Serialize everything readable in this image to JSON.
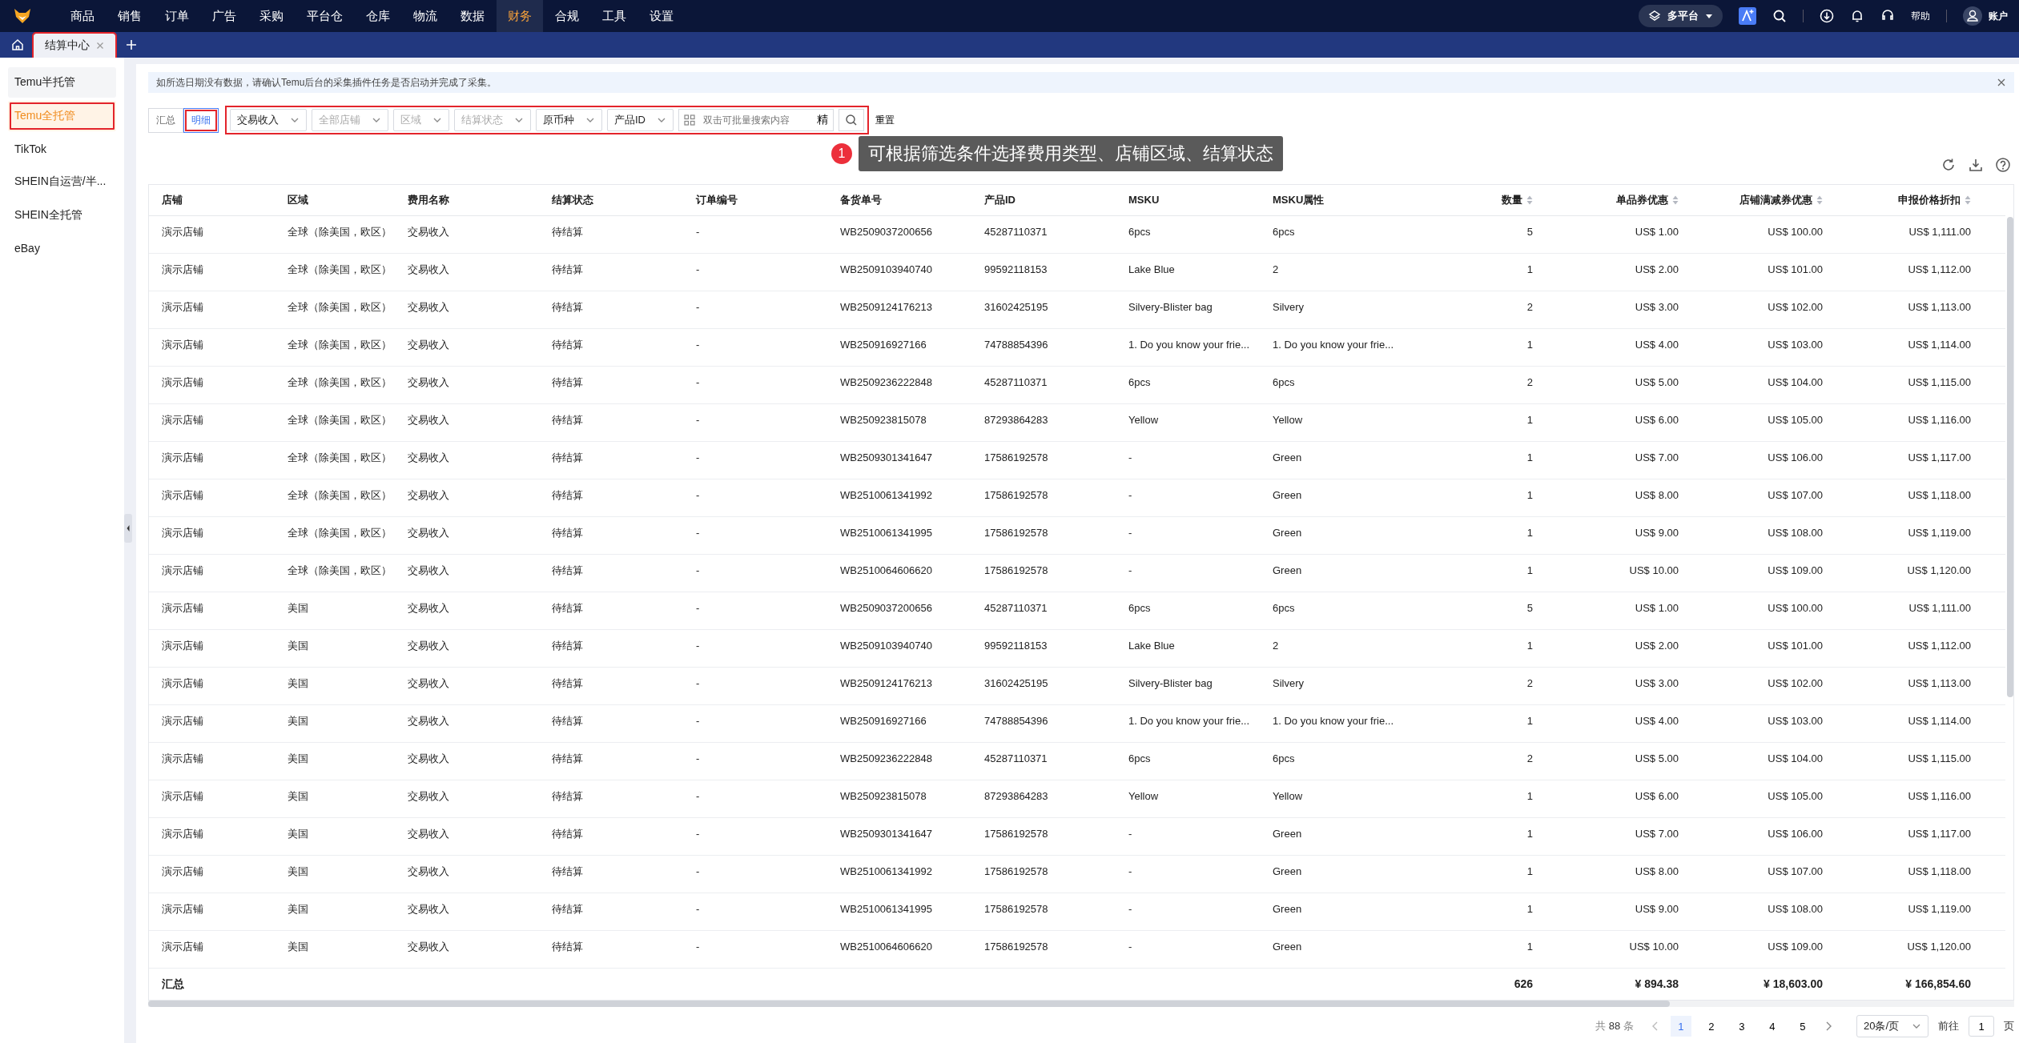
{
  "nav": {
    "menu": [
      {
        "label": "商品",
        "selected": false
      },
      {
        "label": "销售",
        "selected": false
      },
      {
        "label": "订单",
        "selected": false
      },
      {
        "label": "广告",
        "selected": false
      },
      {
        "label": "采购",
        "selected": false
      },
      {
        "label": "平台仓",
        "selected": false
      },
      {
        "label": "仓库",
        "selected": false
      },
      {
        "label": "物流",
        "selected": false
      },
      {
        "label": "数据",
        "selected": false
      },
      {
        "label": "财务",
        "selected": true
      },
      {
        "label": "合规",
        "selected": false
      },
      {
        "label": "工具",
        "selected": false
      },
      {
        "label": "设置",
        "selected": false
      }
    ],
    "platform": "多平台",
    "help": "帮助",
    "account": "账户"
  },
  "tabs": [
    {
      "label": "结算中心",
      "selected": true,
      "highlighted": true
    }
  ],
  "sidebar": {
    "items": [
      {
        "label": "Temu半托管",
        "selected": false,
        "highlighted": false
      },
      {
        "label": "Temu全托管",
        "selected": true,
        "highlighted": true
      },
      {
        "label": "TikTok",
        "selected": false,
        "highlighted": false
      },
      {
        "label": "SHEIN自运营/半...",
        "selected": false,
        "highlighted": false
      },
      {
        "label": "SHEIN全托管",
        "selected": false,
        "highlighted": false
      },
      {
        "label": "eBay",
        "selected": false,
        "highlighted": false
      }
    ]
  },
  "notice": "如所选日期没有数据，请确认Temu后台的采集插件任务是否启动并完成了采集。",
  "view_toggle": [
    {
      "label": "汇总",
      "selected": false,
      "highlighted": false
    },
    {
      "label": "明细",
      "selected": true,
      "highlighted": true
    }
  ],
  "filters": {
    "highlighted": true,
    "items": [
      {
        "kind": "value",
        "text": "交易收入"
      },
      {
        "kind": "placeholder",
        "text": "全部店铺"
      },
      {
        "kind": "placeholder",
        "text": "区域"
      },
      {
        "kind": "placeholder",
        "text": "结算状态"
      },
      {
        "kind": "value",
        "text": "原币种"
      },
      {
        "kind": "value",
        "text": "产品ID"
      }
    ],
    "search": {
      "placeholder": "双击可批量搜索内容",
      "exact": "精"
    },
    "reset": "重置"
  },
  "callout": {
    "number": "1",
    "text": "可根据筛选条件选择费用类型、店铺区域、结算状态"
  },
  "table": {
    "columns": [
      {
        "label": "店铺",
        "kind": "text",
        "sortable": false
      },
      {
        "label": "区域",
        "kind": "text",
        "sortable": false
      },
      {
        "label": "费用名称",
        "kind": "text",
        "sortable": false
      },
      {
        "label": "结算状态",
        "kind": "text",
        "sortable": false
      },
      {
        "label": "订单编号",
        "kind": "text",
        "sortable": false
      },
      {
        "label": "备货单号",
        "kind": "text",
        "sortable": false
      },
      {
        "label": "产品ID",
        "kind": "text",
        "sortable": false
      },
      {
        "label": "MSKU",
        "kind": "text",
        "sortable": false
      },
      {
        "label": "MSKU属性",
        "kind": "text",
        "sortable": false
      },
      {
        "label": "数量",
        "kind": "number",
        "sortable": true
      },
      {
        "label": "单品券优惠",
        "kind": "number",
        "sortable": true
      },
      {
        "label": "店铺满减券优惠",
        "kind": "number",
        "sortable": true
      },
      {
        "label": "申报价格折扣",
        "kind": "number",
        "sortable": true
      }
    ],
    "rows": [
      [
        "演示店铺",
        "全球（除美国，欧区）",
        "交易收入",
        "待结算",
        "-",
        "WB2509037200656",
        "45287110371",
        "6pcs",
        "6pcs",
        "5",
        "US$ 1.00",
        "US$ 100.00",
        "US$ 1,111.00"
      ],
      [
        "演示店铺",
        "全球（除美国，欧区）",
        "交易收入",
        "待结算",
        "-",
        "WB2509103940740",
        "99592118153",
        "Lake Blue",
        "2",
        "1",
        "US$ 2.00",
        "US$ 101.00",
        "US$ 1,112.00"
      ],
      [
        "演示店铺",
        "全球（除美国，欧区）",
        "交易收入",
        "待结算",
        "-",
        "WB2509124176213",
        "31602425195",
        "Silvery-Blister bag",
        "Silvery",
        "2",
        "US$ 3.00",
        "US$ 102.00",
        "US$ 1,113.00"
      ],
      [
        "演示店铺",
        "全球（除美国，欧区）",
        "交易收入",
        "待结算",
        "-",
        "WB250916927166",
        "74788854396",
        "1. Do you know your frie...",
        "1. Do you know your frie...",
        "1",
        "US$ 4.00",
        "US$ 103.00",
        "US$ 1,114.00"
      ],
      [
        "演示店铺",
        "全球（除美国，欧区）",
        "交易收入",
        "待结算",
        "-",
        "WB2509236222848",
        "45287110371",
        "6pcs",
        "6pcs",
        "2",
        "US$ 5.00",
        "US$ 104.00",
        "US$ 1,115.00"
      ],
      [
        "演示店铺",
        "全球（除美国，欧区）",
        "交易收入",
        "待结算",
        "-",
        "WB250923815078",
        "87293864283",
        "Yellow",
        "Yellow",
        "1",
        "US$ 6.00",
        "US$ 105.00",
        "US$ 1,116.00"
      ],
      [
        "演示店铺",
        "全球（除美国，欧区）",
        "交易收入",
        "待结算",
        "-",
        "WB2509301341647",
        "17586192578",
        "-",
        "Green",
        "1",
        "US$ 7.00",
        "US$ 106.00",
        "US$ 1,117.00"
      ],
      [
        "演示店铺",
        "全球（除美国，欧区）",
        "交易收入",
        "待结算",
        "-",
        "WB2510061341992",
        "17586192578",
        "-",
        "Green",
        "1",
        "US$ 8.00",
        "US$ 107.00",
        "US$ 1,118.00"
      ],
      [
        "演示店铺",
        "全球（除美国，欧区）",
        "交易收入",
        "待结算",
        "-",
        "WB2510061341995",
        "17586192578",
        "-",
        "Green",
        "1",
        "US$ 9.00",
        "US$ 108.00",
        "US$ 1,119.00"
      ],
      [
        "演示店铺",
        "全球（除美国，欧区）",
        "交易收入",
        "待结算",
        "-",
        "WB2510064606620",
        "17586192578",
        "-",
        "Green",
        "1",
        "US$ 10.00",
        "US$ 109.00",
        "US$ 1,120.00"
      ],
      [
        "演示店铺",
        "美国",
        "交易收入",
        "待结算",
        "-",
        "WB2509037200656",
        "45287110371",
        "6pcs",
        "6pcs",
        "5",
        "US$ 1.00",
        "US$ 100.00",
        "US$ 1,111.00"
      ],
      [
        "演示店铺",
        "美国",
        "交易收入",
        "待结算",
        "-",
        "WB2509103940740",
        "99592118153",
        "Lake Blue",
        "2",
        "1",
        "US$ 2.00",
        "US$ 101.00",
        "US$ 1,112.00"
      ],
      [
        "演示店铺",
        "美国",
        "交易收入",
        "待结算",
        "-",
        "WB2509124176213",
        "31602425195",
        "Silvery-Blister bag",
        "Silvery",
        "2",
        "US$ 3.00",
        "US$ 102.00",
        "US$ 1,113.00"
      ],
      [
        "演示店铺",
        "美国",
        "交易收入",
        "待结算",
        "-",
        "WB250916927166",
        "74788854396",
        "1. Do you know your frie...",
        "1. Do you know your frie...",
        "1",
        "US$ 4.00",
        "US$ 103.00",
        "US$ 1,114.00"
      ],
      [
        "演示店铺",
        "美国",
        "交易收入",
        "待结算",
        "-",
        "WB2509236222848",
        "45287110371",
        "6pcs",
        "6pcs",
        "2",
        "US$ 5.00",
        "US$ 104.00",
        "US$ 1,115.00"
      ],
      [
        "演示店铺",
        "美国",
        "交易收入",
        "待结算",
        "-",
        "WB250923815078",
        "87293864283",
        "Yellow",
        "Yellow",
        "1",
        "US$ 6.00",
        "US$ 105.00",
        "US$ 1,116.00"
      ],
      [
        "演示店铺",
        "美国",
        "交易收入",
        "待结算",
        "-",
        "WB2509301341647",
        "17586192578",
        "-",
        "Green",
        "1",
        "US$ 7.00",
        "US$ 106.00",
        "US$ 1,117.00"
      ],
      [
        "演示店铺",
        "美国",
        "交易收入",
        "待结算",
        "-",
        "WB2510061341992",
        "17586192578",
        "-",
        "Green",
        "1",
        "US$ 8.00",
        "US$ 107.00",
        "US$ 1,118.00"
      ],
      [
        "演示店铺",
        "美国",
        "交易收入",
        "待结算",
        "-",
        "WB2510061341995",
        "17586192578",
        "-",
        "Green",
        "1",
        "US$ 9.00",
        "US$ 108.00",
        "US$ 1,119.00"
      ],
      [
        "演示店铺",
        "美国",
        "交易收入",
        "待结算",
        "-",
        "WB2510064606620",
        "17586192578",
        "-",
        "Green",
        "1",
        "US$ 10.00",
        "US$ 109.00",
        "US$ 1,120.00"
      ]
    ],
    "summary": {
      "label": "汇总",
      "totals": [
        "626",
        "¥ 894.38",
        "¥ 18,603.00",
        "¥ 166,854.60"
      ]
    }
  },
  "pagination": {
    "total_prefix": "共",
    "total": "88",
    "total_suffix": "条",
    "pages": [
      {
        "label": "1",
        "selected": true
      },
      {
        "label": "2",
        "selected": false
      },
      {
        "label": "3",
        "selected": false
      },
      {
        "label": "4",
        "selected": false
      },
      {
        "label": "5",
        "selected": false
      }
    ],
    "page_size": "20条/页",
    "goto_label": "前往",
    "goto_value": "1",
    "goto_suffix": "页"
  }
}
